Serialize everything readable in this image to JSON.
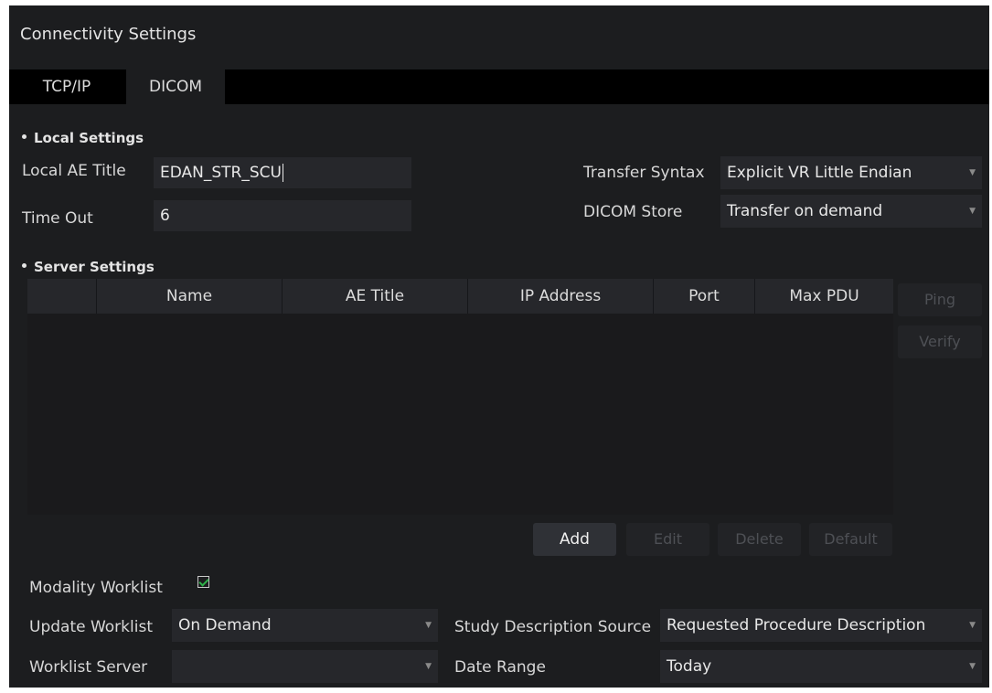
{
  "window": {
    "title": "Connectivity Settings"
  },
  "tabs": [
    {
      "label": "TCP/IP",
      "active": false
    },
    {
      "label": "DICOM",
      "active": true
    }
  ],
  "local_settings": {
    "heading": "Local Settings",
    "ae_title_label": "Local AE Title",
    "ae_title_value": "EDAN_STR_SCU",
    "timeout_label": "Time Out",
    "timeout_value": "6",
    "transfer_syntax_label": "Transfer Syntax",
    "transfer_syntax_value": "Explicit VR Little Endian",
    "dicom_store_label": "DICOM Store",
    "dicom_store_value": "Transfer on demand"
  },
  "server_settings": {
    "heading": "Server Settings",
    "columns": [
      "",
      "Name",
      "AE Title",
      "IP Address",
      "Port",
      "Max PDU"
    ],
    "rows": [],
    "side_buttons": {
      "ping": "Ping",
      "verify": "Verify"
    },
    "buttons": {
      "add": "Add",
      "edit": "Edit",
      "delete": "Delete",
      "default": "Default"
    }
  },
  "worklist": {
    "modality_label": "Modality Worklist",
    "modality_checked": true,
    "update_label": "Update Worklist",
    "update_value": "On Demand",
    "server_label": "Worklist Server",
    "server_value": "",
    "study_desc_label": "Study Description Source",
    "study_desc_value": "Requested Procedure Description",
    "date_range_label": "Date Range",
    "date_range_value": "Today"
  },
  "colors": {
    "background": "#1c1d1f",
    "field": "#26272b",
    "checkmark": "#2fb14a",
    "disabled_text": "#4e5055"
  },
  "icons": {
    "dropdown": "chevron-down-icon",
    "checkbox": "checkbox-checked-icon"
  }
}
